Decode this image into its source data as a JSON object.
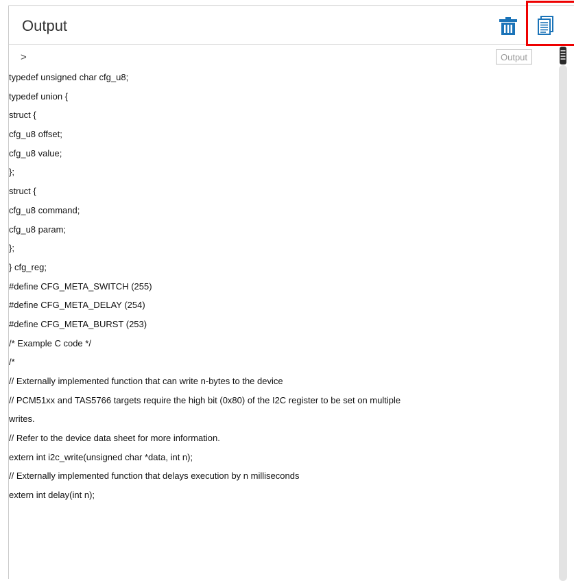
{
  "panel": {
    "title": "Output",
    "trash_icon": "trash-icon",
    "copy_icon": "copy-document-icon",
    "accent_color": "#1a73b8",
    "highlight_color": "#ee0000"
  },
  "console": {
    "prompt": ">",
    "tooltip": "Output",
    "lines": [
      "typedef unsigned char cfg_u8;",
      "typedef union {",
      "struct {",
      "cfg_u8 offset;",
      "cfg_u8 value;",
      "};",
      "struct {",
      "cfg_u8 command;",
      "cfg_u8 param;",
      "};",
      "} cfg_reg;",
      "#define CFG_META_SWITCH (255)",
      "#define CFG_META_DELAY (254)",
      "#define CFG_META_BURST (253)",
      "/* Example C code */",
      "/*",
      "// Externally implemented function that can write n-bytes to the device",
      "// PCM51xx and TAS5766 targets require the high bit (0x80) of the I2C register to be set on multiple",
      "writes.",
      "// Refer to the device data sheet for more information.",
      "extern int i2c_write(unsigned char *data, int n);",
      "// Externally implemented function that delays execution by n milliseconds",
      "extern int delay(int n);"
    ]
  }
}
